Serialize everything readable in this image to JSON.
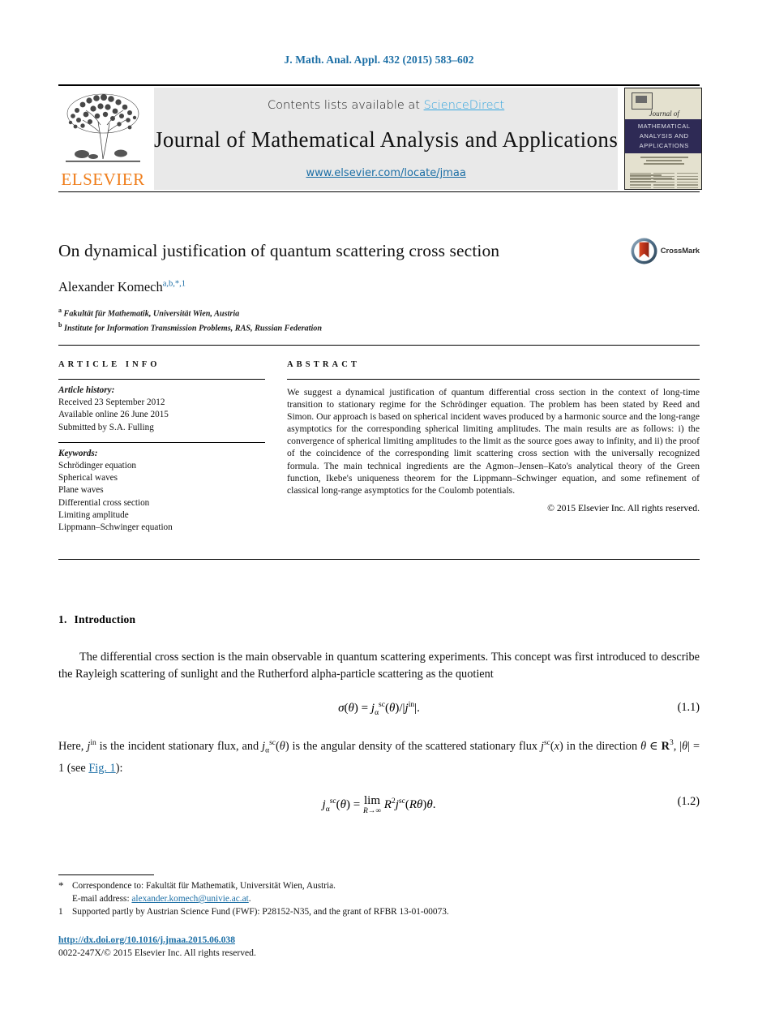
{
  "running_head": "J. Math. Anal. Appl. 432 (2015) 583–602",
  "masthead": {
    "contents_prefix": "Contents lists available at ",
    "sciencedirect": "ScienceDirect",
    "journal_name": "Journal of Mathematical Analysis and Applications",
    "journal_url": "www.elsevier.com/locate/jmaa",
    "publisher_wordmark": "ELSEVIER",
    "cover": {
      "journal_of": "Journal of",
      "band_line1": "MATHEMATICAL",
      "band_line2": "ANALYSIS AND",
      "band_line3": "APPLICATIONS"
    }
  },
  "article": {
    "title": "On dynamical justification of quantum scattering cross section",
    "crossmark_label": "CrossMark",
    "author": "Alexander Komech",
    "author_marks": "a,b,*,1",
    "affiliations": [
      {
        "mark": "a",
        "text": "Fakultät für Mathematik, Universität Wien, Austria"
      },
      {
        "mark": "b",
        "text": "Institute for Information Transmission Problems, RAS, Russian Federation"
      }
    ]
  },
  "info": {
    "heading": "ARTICLE INFO",
    "history_heading": "Article history:",
    "history": [
      "Received 23 September 2012",
      "Available online 26 June 2015",
      "Submitted by S.A. Fulling"
    ],
    "keywords_heading": "Keywords:",
    "keywords": [
      "Schrödinger equation",
      "Spherical waves",
      "Plane waves",
      "Differential cross section",
      "Limiting amplitude",
      "Lippmann–Schwinger equation"
    ]
  },
  "abstract": {
    "heading": "ABSTRACT",
    "text": "We suggest a dynamical justification of quantum differential cross section in the context of long-time transition to stationary regime for the Schrödinger equation. The problem has been stated by Reed and Simon. Our approach is based on spherical incident waves produced by a harmonic source and the long-range asymptotics for the corresponding spherical limiting amplitudes. The main results are as follows: i) the convergence of spherical limiting amplitudes to the limit as the source goes away to infinity, and ii) the proof of the coincidence of the corresponding limit scattering cross section with the universally recognized formula. The main technical ingredients are the Agmon–Jensen–Kato's analytical theory of the Green function, Ikebe's uniqueness theorem for the Lippmann–Schwinger equation, and some refinement of classical long-range asymptotics for the Coulomb potentials.",
    "copyright": "© 2015 Elsevier Inc. All rights reserved."
  },
  "body": {
    "section_number": "1.",
    "section_title": "Introduction",
    "paragraph1": "The differential cross section is the main observable in quantum scattering experiments. This concept was first introduced to describe the Rayleigh scattering of sunlight and the Rutherford alpha-particle scattering as the quotient",
    "equation1_tag": "(1.1)",
    "paragraph2_pre": "Here, ",
    "paragraph2_mid": " is the incident stationary flux, and ",
    "paragraph2_post": " is the angular density of the scattered stationary flux",
    "paragraph2_line2_a": " in the direction ",
    "paragraph2_fig_link": "Fig. 1",
    "equation2_tag": "(1.2)"
  },
  "footnotes": [
    {
      "mark": "*",
      "text": "Correspondence to: Fakultät für Mathematik, Universität Wien, Austria."
    },
    {
      "mark": "1",
      "text": "Supported partly by Austrian Science Fund (FWF): P28152-N35, and the grant of RFBR 13-01-00073."
    }
  ],
  "email": {
    "label": "E-mail address:",
    "address": "alexander.komech@univie.ac.at"
  },
  "bottom": {
    "doi": "http://dx.doi.org/10.1016/j.jmaa.2015.06.038",
    "issn": "0022-247X/© 2015 Elsevier Inc. All rights reserved."
  },
  "colors": {
    "link_blue": "#1b6ea5",
    "sciencedirect_blue": "#37a6de",
    "elsevier_orange": "#ef7d1a",
    "cover_band": "#2e2a55",
    "cover_bg": "#e4e1cf",
    "masthead_grey": "#e9e9e9"
  }
}
